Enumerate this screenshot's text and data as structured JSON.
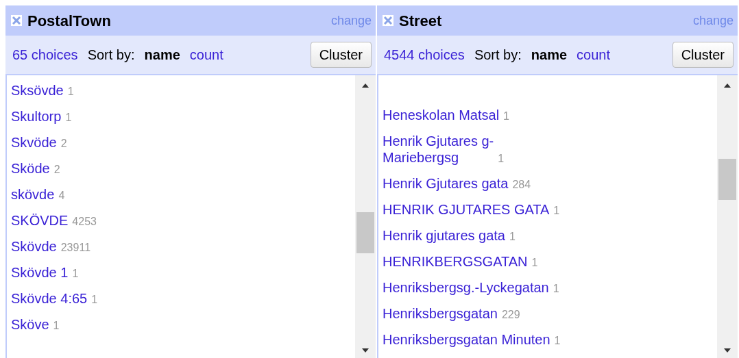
{
  "facets": [
    {
      "title": "PostalTown",
      "change": "change",
      "choices": "65 choices",
      "sort_label": "Sort by:",
      "sort_options": [
        {
          "label": "name",
          "selected": true
        },
        {
          "label": "count",
          "selected": false
        }
      ],
      "cluster": "Cluster",
      "items": [
        {
          "name": "Sksövde",
          "count": "1"
        },
        {
          "name": "Skultorp",
          "count": "1"
        },
        {
          "name": "Skvöde",
          "count": "2"
        },
        {
          "name": "Sköde",
          "count": "2"
        },
        {
          "name": "skövde",
          "count": "4"
        },
        {
          "name": "SKÖVDE",
          "count": "4253"
        },
        {
          "name": "Skövde",
          "count": "23911"
        },
        {
          "name": "Skövde 1",
          "count": "1"
        },
        {
          "name": "Skövde 4:65",
          "count": "1"
        },
        {
          "name": "Sköve",
          "count": "1"
        }
      ]
    },
    {
      "title": "Street",
      "change": "change",
      "choices": "4544 choices",
      "sort_label": "Sort by:",
      "sort_options": [
        {
          "label": "name",
          "selected": true
        },
        {
          "label": "count",
          "selected": false
        }
      ],
      "cluster": "Cluster",
      "items": [
        {
          "name": "Heneskolan Matsal",
          "count": "1"
        },
        {
          "name": "Henrik Gjutares g-\nMariebergsg",
          "count": "1"
        },
        {
          "name": "Henrik Gjutares gata",
          "count": "284"
        },
        {
          "name": "HENRIK GJUTARES GATA",
          "count": "1"
        },
        {
          "name": "Henrik gjutares gata",
          "count": "1"
        },
        {
          "name": "HENRIKBERGSGATAN",
          "count": "1"
        },
        {
          "name": "Henriksbergsg.-Lyckegatan",
          "count": "1"
        },
        {
          "name": "Henriksbergsgatan",
          "count": "229"
        },
        {
          "name": "Henriksbergsgatan Minuten",
          "count": "1"
        }
      ]
    }
  ]
}
